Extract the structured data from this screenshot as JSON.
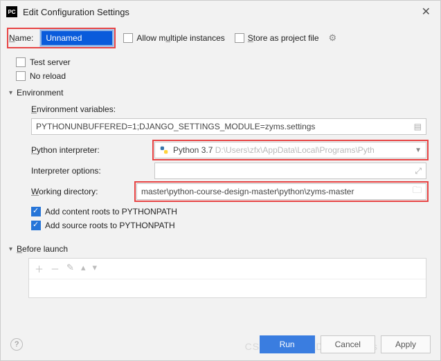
{
  "title": "Edit Configuration Settings",
  "name": {
    "label": "Name:",
    "value": "Unnamed"
  },
  "allow_multiple": "Allow multiple instances",
  "store_project": "Store as project file",
  "test_server": "Test server",
  "no_reload": "No reload",
  "environment": {
    "heading": "Environment",
    "env_vars_label": "Environment variables:",
    "env_vars_value": "PYTHONUNBUFFERED=1;DJANGO_SETTINGS_MODULE=zyms.settings",
    "interpreter_label": "Python interpreter:",
    "interpreter_value": "Python 3.7",
    "interpreter_path": "D:\\Users\\zfx\\AppData\\Local\\Programs\\Pyth",
    "interp_opts_label": "Interpreter options:",
    "interp_opts_value": "",
    "workdir_label": "Working directory:",
    "workdir_value": "master\\python-course-design-master\\python\\zyms-master",
    "add_content_roots": "Add content roots to PYTHONPATH",
    "add_source_roots": "Add source roots to PYTHONPATH"
  },
  "before_launch": "Before launch",
  "buttons": {
    "run": "Run",
    "cancel": "Cancel",
    "apply": "Apply"
  },
  "watermark": "CSDN @MegaDataFlowers"
}
